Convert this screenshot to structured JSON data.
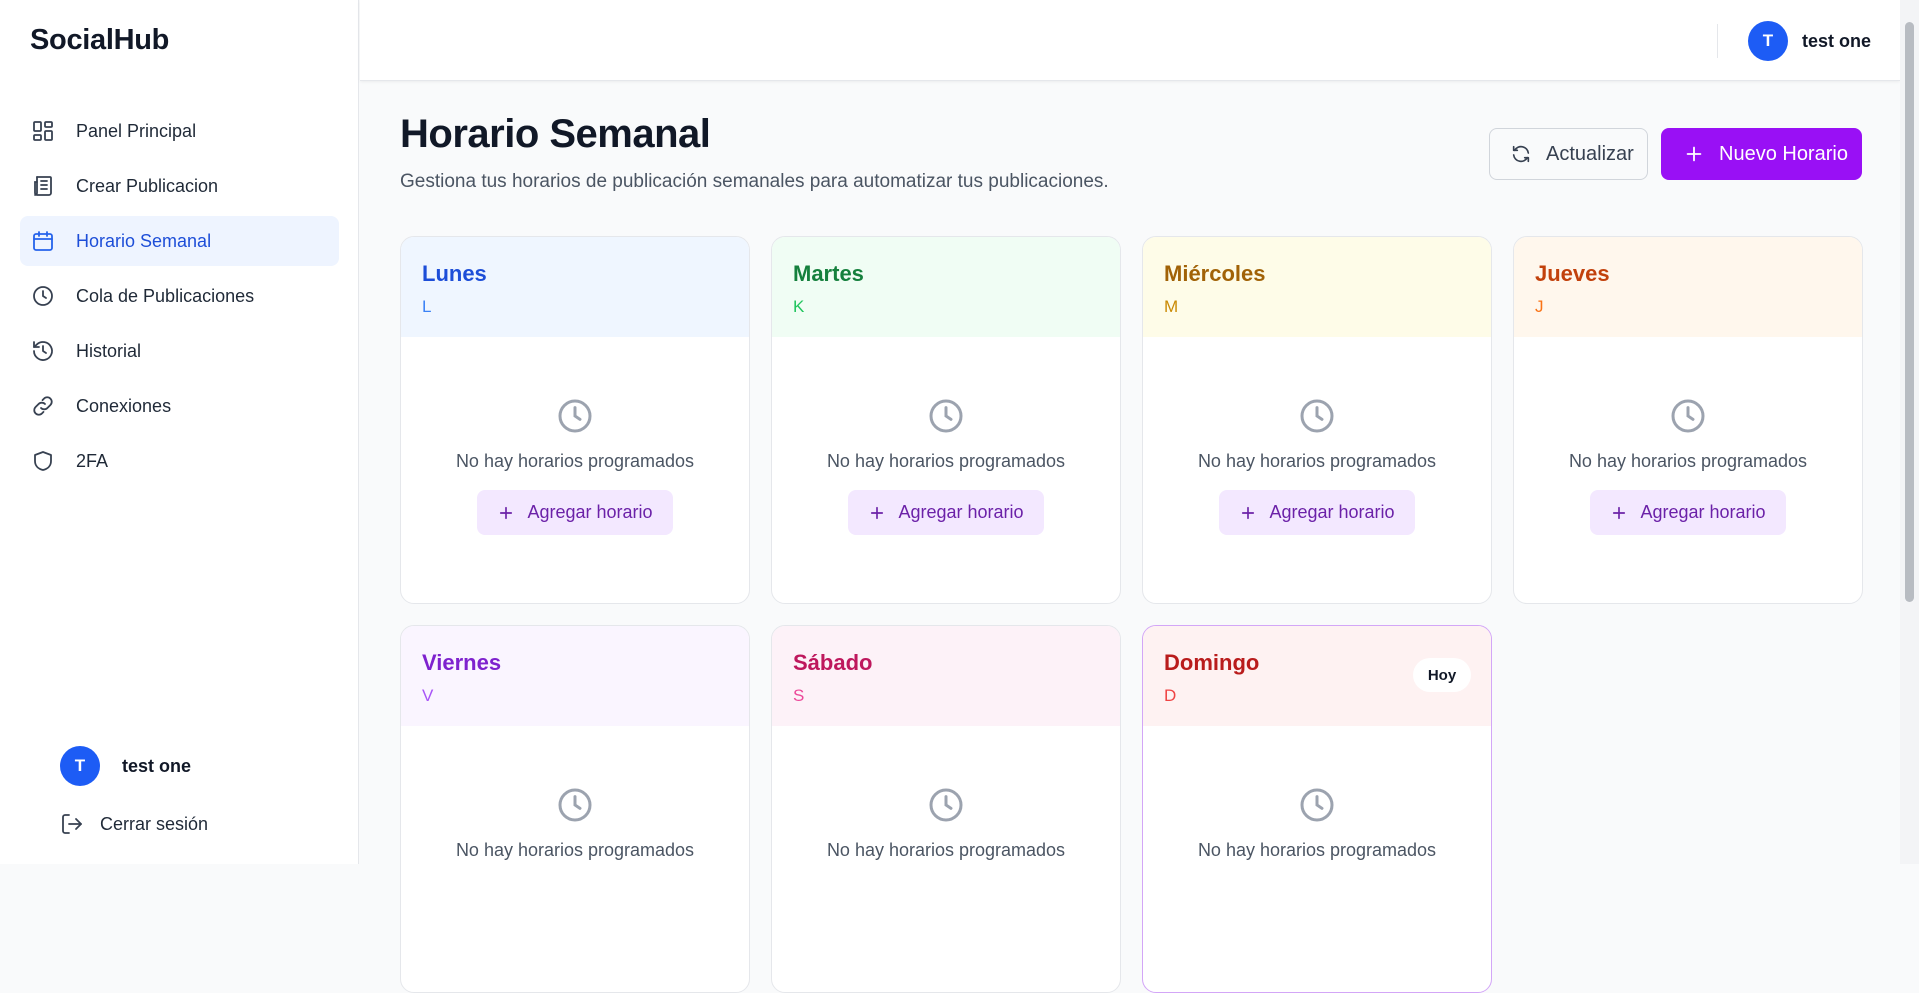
{
  "app": {
    "brand": "SocialHub"
  },
  "sidebar": {
    "items": [
      {
        "label": "Panel Principal",
        "icon": "dashboard-icon"
      },
      {
        "label": "Crear Publicacion",
        "icon": "newspaper-icon"
      },
      {
        "label": "Horario Semanal",
        "icon": "calendar-icon",
        "active": true
      },
      {
        "label": "Cola de Publicaciones",
        "icon": "clock-icon"
      },
      {
        "label": "Historial",
        "icon": "history-icon"
      },
      {
        "label": "Conexiones",
        "icon": "link-icon"
      },
      {
        "label": "2FA",
        "icon": "shield-icon"
      }
    ],
    "user": {
      "initial": "T",
      "name": "test one"
    },
    "logout_label": "Cerrar sesión"
  },
  "header": {
    "user": {
      "initial": "T",
      "name": "test one"
    }
  },
  "main": {
    "title": "Horario Semanal",
    "subtitle": "Gestiona tus horarios de publicación semanales para automatizar tus publicaciones.",
    "refresh_label": "Actualizar",
    "new_label": "Nuevo Horario",
    "empty_text": "No hay horarios programados",
    "add_label": "Agregar horario",
    "today_label": "Hoy",
    "days": [
      {
        "name": "Lunes",
        "abbr": "L",
        "color": "#1d4ed8"
      },
      {
        "name": "Martes",
        "abbr": "K",
        "color": "#15803d"
      },
      {
        "name": "Miércoles",
        "abbr": "M",
        "color": "#a16207"
      },
      {
        "name": "Jueves",
        "abbr": "J",
        "color": "#c2410c"
      },
      {
        "name": "Viernes",
        "abbr": "V",
        "color": "#7e22ce"
      },
      {
        "name": "Sábado",
        "abbr": "S",
        "color": "#be185d"
      },
      {
        "name": "Domingo",
        "abbr": "D",
        "color": "#b91c1c",
        "today": true
      }
    ]
  },
  "colors": {
    "accent": "#9910f5",
    "active_nav": "#1d4ed8",
    "avatar": "#1d5cf5"
  }
}
